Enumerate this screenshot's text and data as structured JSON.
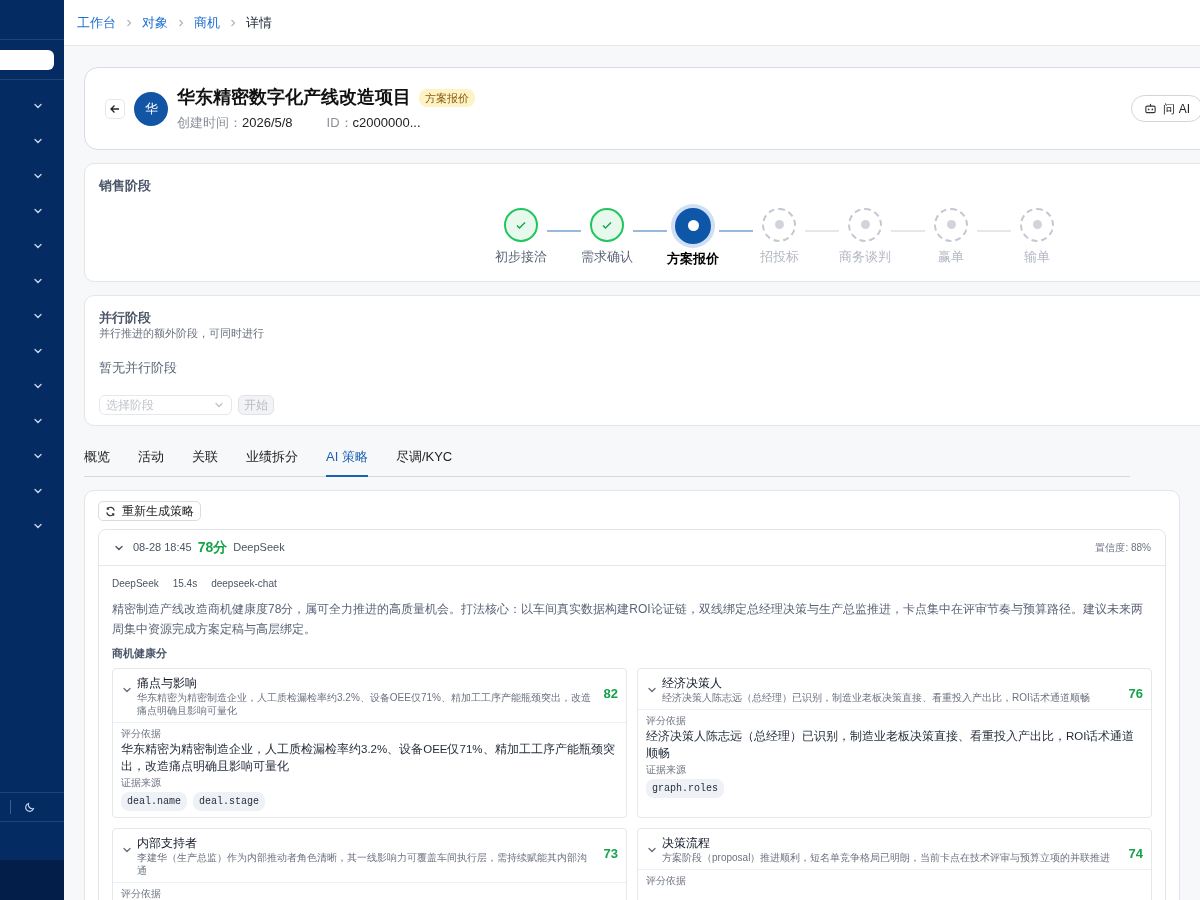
{
  "sidebar": {
    "items": [
      {
        "expanded": false
      },
      {
        "expanded": false
      },
      {
        "expanded": false
      },
      {
        "expanded": false
      },
      {
        "expanded": false
      },
      {
        "expanded": false
      },
      {
        "expanded": false
      },
      {
        "expanded": false
      },
      {
        "expanded": false
      },
      {
        "expanded": false
      },
      {
        "expanded": false
      },
      {
        "expanded": false
      },
      {
        "expanded": false
      }
    ]
  },
  "breadcrumb": [
    {
      "label": "工作台",
      "kind": "link"
    },
    {
      "label": "对象",
      "kind": "link"
    },
    {
      "label": "商机",
      "kind": "link"
    },
    {
      "label": "详情",
      "kind": "current"
    }
  ],
  "header": {
    "avatar": "华",
    "title": "华东精密数字化产线改造项目",
    "status_tag": "方案报价",
    "created_label": "创建时间：",
    "created": "2026/5/8",
    "id_label": "ID：",
    "id": "c2000000...",
    "ai_button": "问 AI"
  },
  "sales_stage": {
    "title": "销售阶段",
    "stages": [
      {
        "label": "初步接洽",
        "completed": true,
        "selected": false
      },
      {
        "label": "需求确认",
        "completed": true,
        "selected": false
      },
      {
        "label": "方案报价",
        "completed": false,
        "selected": true
      },
      {
        "label": "招投标",
        "completed": false,
        "selected": false
      },
      {
        "label": "商务谈判",
        "completed": false,
        "selected": false
      },
      {
        "label": "赢单",
        "completed": false,
        "selected": false
      },
      {
        "label": "输单",
        "completed": false,
        "selected": false
      }
    ]
  },
  "parallel": {
    "title": "并行阶段",
    "subtitle": "并行推进的额外阶段，可同时进行",
    "empty": "暂无并行阶段",
    "select_placeholder": "选择阶段",
    "start_button": "开始",
    "start_disabled": true
  },
  "tabs": [
    {
      "label": "概览",
      "selected": false
    },
    {
      "label": "活动",
      "selected": false
    },
    {
      "label": "关联",
      "selected": false
    },
    {
      "label": "业绩拆分",
      "selected": false
    },
    {
      "label": "AI 策略",
      "selected": true
    },
    {
      "label": "尽调/KYC",
      "selected": false
    }
  ],
  "strategy": {
    "regenerate_button": "重新生成策略",
    "record": {
      "expanded": true,
      "time": "08-28 18:45",
      "score": "78分",
      "model": "DeepSeek",
      "confidence": "置信度: 88%",
      "meta": [
        "DeepSeek",
        "15.4s",
        "deepseek-chat"
      ],
      "summary": "精密制造产线改造商机健康度78分，属可全力推进的高质量机会。打法核心：以车间真实数据构建ROI论证链，双线绑定总经理决策与生产总监推进，卡点集中在评审节奏与预算路径。建议未来两周集中资源完成方案定稿与高层绑定。",
      "health_title": "商机健康分",
      "items": [
        {
          "title": "痛点与影响",
          "desc": "华东精密为精密制造企业，人工质检漏检率约3.2%、设备OEE仅71%、精加工工序产能瓶颈突出，改造痛点明确且影响可量化",
          "score": "82",
          "basis_label": "评分依据",
          "basis": "华东精密为精密制造企业，人工质检漏检率约3.2%、设备OEE仅71%、精加工工序产能瓶颈突出，改造痛点明确且影响可量化",
          "source_label": "证据来源",
          "sources": [
            "deal.name",
            "deal.stage"
          ]
        },
        {
          "title": "经济决策人",
          "desc": "经济决策人陈志远（总经理）已识别，制造业老板决策直接、看重投入产出比，ROI话术通道顺畅",
          "score": "76",
          "basis_label": "评分依据",
          "basis": "经济决策人陈志远（总经理）已识别，制造业老板决策直接、看重投入产出比，ROI话术通道顺畅",
          "source_label": "证据来源",
          "sources": [
            "graph.roles"
          ]
        },
        {
          "title": "内部支持者",
          "desc": "李建华（生产总监）作为内部推动者角色清晰，其一线影响力可覆盖车间执行层，需持续赋能其内部沟通",
          "score": "73",
          "basis_label": "评分依据"
        },
        {
          "title": "决策流程",
          "desc": "方案阶段（proposal）推进顺利，短名单竞争格局已明朗，当前卡点在技术评审与预算立项的并联推进",
          "score": "74",
          "basis_label": "评分依据"
        }
      ]
    }
  }
}
